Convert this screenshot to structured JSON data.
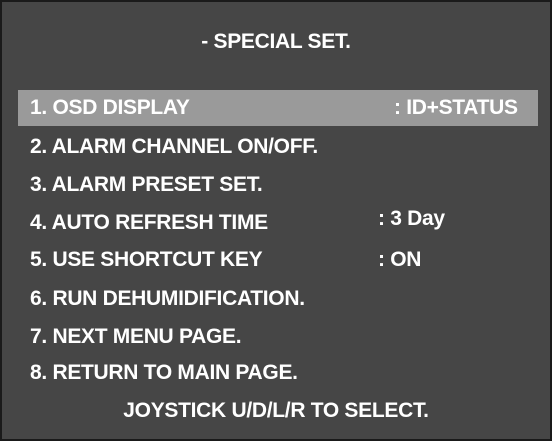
{
  "osd": {
    "title": "- SPECIAL SET.",
    "selected_index": 0,
    "menu_items": [
      {
        "label": "1. OSD DISPLAY",
        "value": ": ID+STATUS"
      },
      {
        "label": "2. ALARM CHANNEL ON/OFF.",
        "value": ""
      },
      {
        "label": "3. ALARM PRESET SET.",
        "value": ""
      },
      {
        "label": "4. AUTO REFRESH TIME",
        "value": ": 3 Day"
      },
      {
        "label": "5. USE SHORTCUT KEY",
        "value": ": ON"
      },
      {
        "label": "6. RUN DEHUMIDIFICATION.",
        "value": ""
      },
      {
        "label": "7. NEXT MENU PAGE.",
        "value": ""
      },
      {
        "label": "8. RETURN TO MAIN PAGE.",
        "value": ""
      }
    ],
    "footer": "JOYSTICK U/D/L/R TO SELECT."
  },
  "colors": {
    "background": "#464646",
    "highlight": "#9a9a9a",
    "text": "#ffffff",
    "border": "#1a1a1a"
  }
}
